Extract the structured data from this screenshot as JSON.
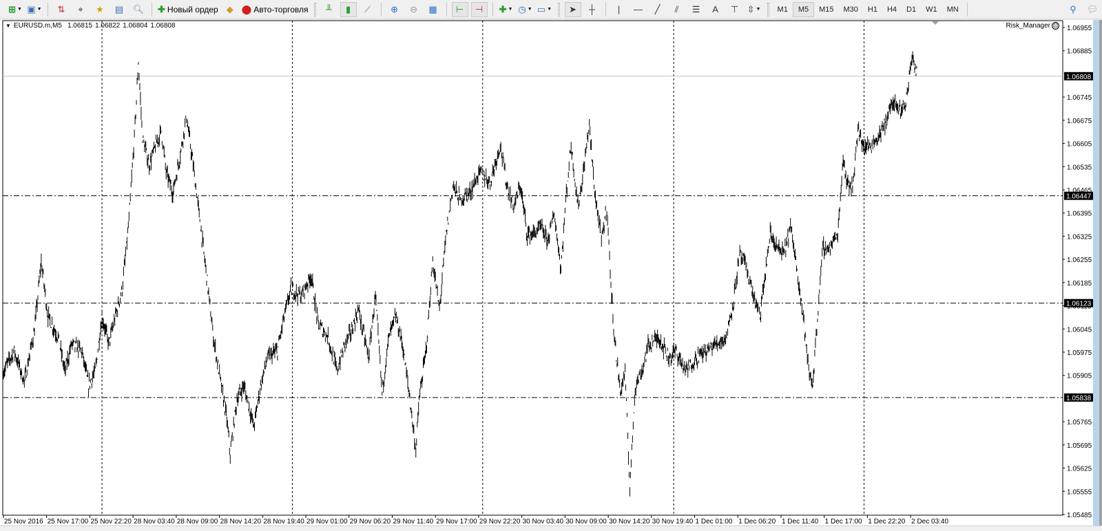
{
  "toolbar": {
    "new_order_label": "Новый ордер",
    "autotrading_label": "Авто-торговля",
    "timeframes": [
      "M1",
      "M5",
      "M15",
      "M30",
      "H1",
      "H4",
      "D1",
      "W1",
      "MN"
    ],
    "active_timeframe": "M5"
  },
  "chart": {
    "symbol_info": "EURUSD.m,M5",
    "open": "1.06815",
    "high": "1.06822",
    "low": "1.06804",
    "close": "1.06808",
    "expert_name": "Risk_Manager",
    "expert_face": "☹"
  },
  "chart_data": {
    "type": "line",
    "title": "EURUSD.m,M5",
    "ylim": [
      1.05485,
      1.06955
    ],
    "y_ticks": [
      "1.06955",
      "1.06885",
      "1.06745",
      "1.06675",
      "1.06605",
      "1.06535",
      "1.06465",
      "1.06395",
      "1.06325",
      "1.06255",
      "1.06185",
      "1.06115",
      "1.06045",
      "1.05975",
      "1.05905",
      "1.05765",
      "1.05695",
      "1.05625",
      "1.05555",
      "1.05485"
    ],
    "x_ticks": [
      "25 Nov 2016",
      "25 Nov 17:00",
      "25 Nov 22:20",
      "28 Nov 03:40",
      "28 Nov 09:00",
      "28 Nov 14:20",
      "28 Nov 19:40",
      "29 Nov 01:00",
      "29 Nov 06:20",
      "29 Nov 11:40",
      "29 Nov 17:00",
      "29 Nov 22:20",
      "30 Nov 03:40",
      "30 Nov 09:00",
      "30 Nov 14:20",
      "30 Nov 19:40",
      "1 Dec 01:00",
      "1 Dec 06:20",
      "1 Dec 11:40",
      "1 Dec 17:00",
      "1 Dec 22:20",
      "2 Dec 03:40"
    ],
    "bars_per_x_tick": 64,
    "current_price": "1.06808",
    "levels": [
      "1.06447",
      "1.06123",
      "1.05838"
    ],
    "day_separator_bars": [
      146,
      428,
      710,
      993,
      1275
    ],
    "series": [
      {
        "name": "EURUSD.m close (approx)",
        "points": [
          [
            0,
            1.05917
          ],
          [
            16,
            1.05979
          ],
          [
            31,
            1.05885
          ],
          [
            46,
            1.06041
          ],
          [
            56,
            1.06249
          ],
          [
            66,
            1.06083
          ],
          [
            81,
            1.0602
          ],
          [
            91,
            1.05917
          ],
          [
            101,
            1.06
          ],
          [
            116,
            1.05979
          ],
          [
            126,
            1.05875
          ],
          [
            136,
            1.05917
          ],
          [
            146,
            1.06083
          ],
          [
            156,
            1.06
          ],
          [
            166,
            1.06083
          ],
          [
            176,
            1.06166
          ],
          [
            186,
            1.06373
          ],
          [
            194,
            1.06623
          ],
          [
            200,
            1.06851
          ],
          [
            206,
            1.06623
          ],
          [
            216,
            1.0654
          ],
          [
            226,
            1.06602
          ],
          [
            234,
            1.06643
          ],
          [
            241,
            1.06519
          ],
          [
            251,
            1.06457
          ],
          [
            261,
            1.0656
          ],
          [
            271,
            1.06685
          ],
          [
            281,
            1.0654
          ],
          [
            291,
            1.06373
          ],
          [
            301,
            1.06207
          ],
          [
            311,
            1.0602
          ],
          [
            321,
            1.05896
          ],
          [
            331,
            1.05771
          ],
          [
            336,
            1.05667
          ],
          [
            346,
            1.05833
          ],
          [
            356,
            1.05875
          ],
          [
            366,
            1.05792
          ],
          [
            371,
            1.0575
          ],
          [
            381,
            1.05875
          ],
          [
            391,
            1.05958
          ],
          [
            406,
            1.05979
          ],
          [
            416,
            1.06083
          ],
          [
            426,
            1.06166
          ],
          [
            441,
            1.06145
          ],
          [
            456,
            1.06207
          ],
          [
            466,
            1.06062
          ],
          [
            481,
            1.0602
          ],
          [
            494,
            1.05917
          ],
          [
            506,
            1.06
          ],
          [
            516,
            1.06041
          ],
          [
            526,
            1.06103
          ],
          [
            541,
            1.05958
          ],
          [
            551,
            1.06145
          ],
          [
            561,
            1.05854
          ],
          [
            571,
            1.0602
          ],
          [
            581,
            1.06083
          ],
          [
            591,
            1.06
          ],
          [
            601,
            1.05854
          ],
          [
            611,
            1.05678
          ],
          [
            616,
            1.05833
          ],
          [
            626,
            1.05979
          ],
          [
            636,
            1.06249
          ],
          [
            646,
            1.06103
          ],
          [
            656,
            1.06332
          ],
          [
            666,
            1.06477
          ],
          [
            676,
            1.06436
          ],
          [
            691,
            1.06457
          ],
          [
            706,
            1.06519
          ],
          [
            721,
            1.06488
          ],
          [
            736,
            1.06602
          ],
          [
            746,
            1.06477
          ],
          [
            756,
            1.06415
          ],
          [
            766,
            1.06477
          ],
          [
            776,
            1.06332
          ],
          [
            786,
            1.06332
          ],
          [
            796,
            1.06353
          ],
          [
            806,
            1.06311
          ],
          [
            816,
            1.06394
          ],
          [
            826,
            1.06228
          ],
          [
            834,
            1.06457
          ],
          [
            841,
            1.06602
          ],
          [
            851,
            1.06415
          ],
          [
            858,
            1.06498
          ],
          [
            868,
            1.06664
          ],
          [
            876,
            1.06457
          ],
          [
            886,
            1.06311
          ],
          [
            894,
            1.06415
          ],
          [
            901,
            1.06145
          ],
          [
            906,
            1.06
          ],
          [
            914,
            1.05854
          ],
          [
            921,
            1.05917
          ],
          [
            928,
            1.05563
          ],
          [
            936,
            1.05875
          ],
          [
            946,
            1.05917
          ],
          [
            956,
            1.06
          ],
          [
            971,
            1.0602
          ],
          [
            986,
            1.05958
          ],
          [
            996,
            1.05979
          ],
          [
            1011,
            1.05917
          ],
          [
            1026,
            1.05958
          ],
          [
            1041,
            1.05979
          ],
          [
            1056,
            1.06
          ],
          [
            1071,
            1.0602
          ],
          [
            1081,
            1.06124
          ],
          [
            1091,
            1.0627
          ],
          [
            1101,
            1.06228
          ],
          [
            1111,
            1.06145
          ],
          [
            1121,
            1.06083
          ],
          [
            1126,
            1.06166
          ],
          [
            1136,
            1.06332
          ],
          [
            1146,
            1.0629
          ],
          [
            1156,
            1.0627
          ],
          [
            1166,
            1.06353
          ],
          [
            1176,
            1.06228
          ],
          [
            1186,
            1.06062
          ],
          [
            1193,
            1.05917
          ],
          [
            1199,
            1.05875
          ],
          [
            1206,
            1.06083
          ],
          [
            1214,
            1.0629
          ],
          [
            1224,
            1.0629
          ],
          [
            1236,
            1.06332
          ],
          [
            1244,
            1.0656
          ],
          [
            1251,
            1.06477
          ],
          [
            1258,
            1.06477
          ],
          [
            1266,
            1.06643
          ],
          [
            1276,
            1.06592
          ],
          [
            1286,
            1.06602
          ],
          [
            1296,
            1.06623
          ],
          [
            1306,
            1.06664
          ],
          [
            1316,
            1.06727
          ],
          [
            1326,
            1.06706
          ],
          [
            1336,
            1.06716
          ],
          [
            1341,
            1.06789
          ],
          [
            1346,
            1.06872
          ],
          [
            1351,
            1.0683
          ],
          [
            1354,
            1.06808
          ]
        ]
      }
    ],
    "grid": false,
    "colors": {
      "bars": "#000000",
      "price_line": "#c0c0c0",
      "label_bg": "#000000",
      "label_fg": "#ffffff"
    }
  }
}
